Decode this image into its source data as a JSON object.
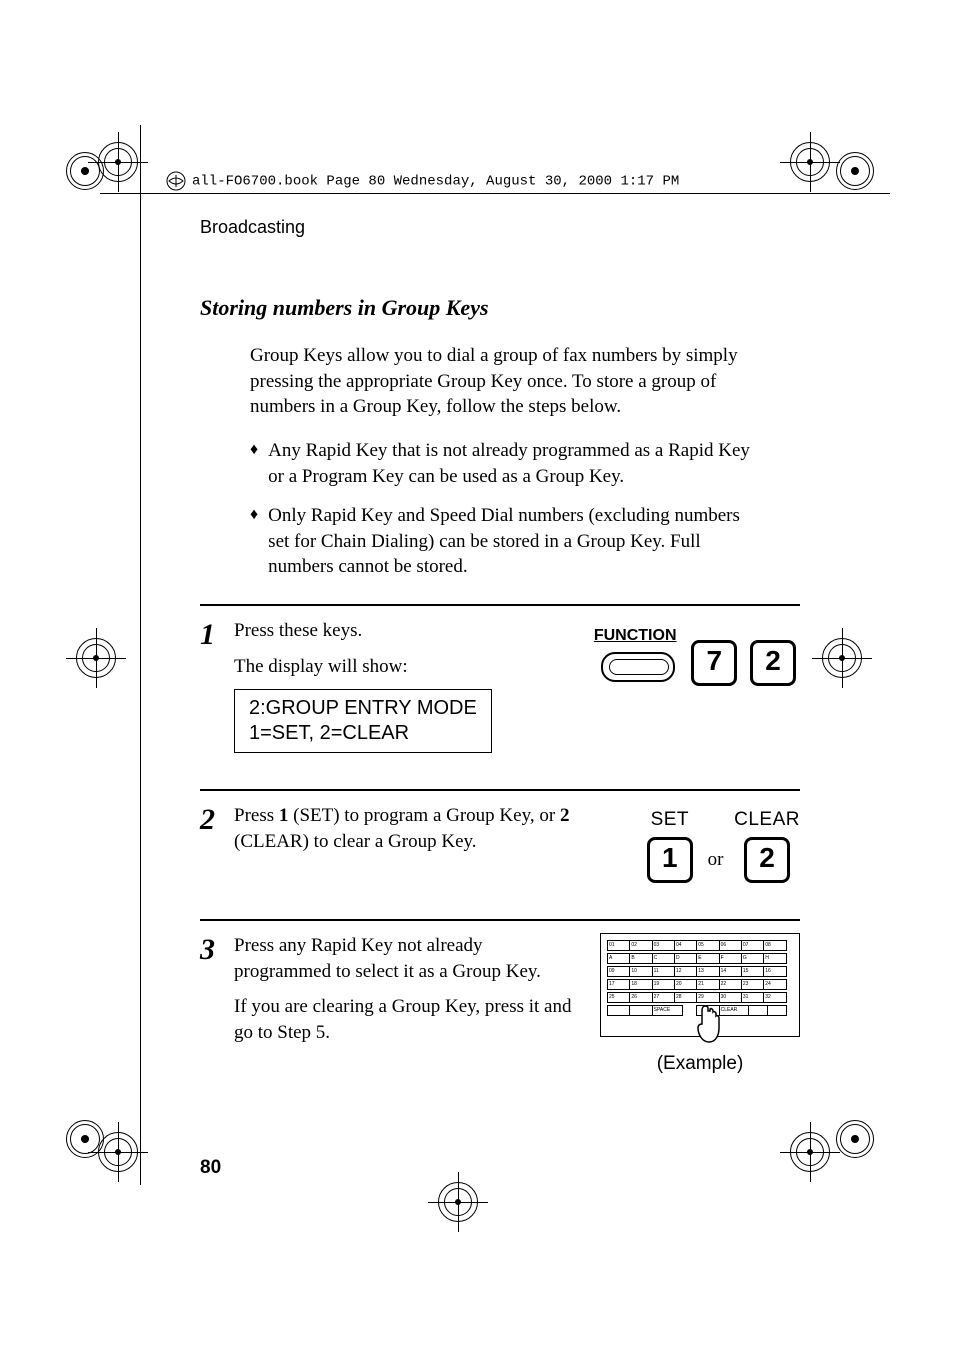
{
  "header": {
    "book_path": "all-FO6700.book  Page 80  Wednesday, August 30, 2000  1:17 PM"
  },
  "running_head": "Broadcasting",
  "section_title": "Storing numbers in Group Keys",
  "intro": "Group Keys allow you to dial a group of fax numbers by simply pressing the appropriate Group Key once. To store a group of numbers in a Group Key, follow the steps below.",
  "bullets": [
    "Any Rapid Key that is not already programmed as a Rapid Key or a Program Key can be used as a Group Key.",
    "Only Rapid Key and Speed Dial numbers (excluding numbers set for Chain Dialing) can be stored in a Group Key. Full numbers cannot be stored."
  ],
  "steps": {
    "s1": {
      "num": "1",
      "text": "Press these keys.",
      "sub": "The display will show:",
      "display_l1": "2:GROUP ENTRY MODE",
      "display_l2": "1=SET, 2=CLEAR",
      "function_label": "FUNCTION",
      "key_a": "7",
      "key_b": "2"
    },
    "s2": {
      "num": "2",
      "text_pre": "Press ",
      "text_b1": "1",
      "text_mid1": " (SET) to program a Group Key, or ",
      "text_b2": "2",
      "text_mid2": " (CLEAR) to clear a Group Key.",
      "label_set": "SET",
      "label_clear": "CLEAR",
      "key_a": "1",
      "or": "or",
      "key_b": "2"
    },
    "s3": {
      "num": "3",
      "text": "Press any Rapid Key not already programmed to select it as a Group Key.",
      "sub": "If you are clearing a Group Key, press it and go to Step 5.",
      "example": "(Example)"
    }
  },
  "page_number": "80"
}
